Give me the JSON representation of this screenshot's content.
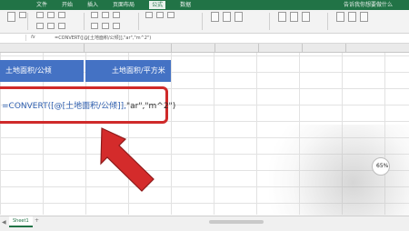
{
  "ribbon": {
    "tab_labels": [
      "文件",
      "开始",
      "插入",
      "页面布局",
      "公式",
      "数据"
    ],
    "right_tab_label": "告诉我你想要做什么"
  },
  "formula_bar": {
    "fx_label": "fx",
    "formula_text": "=CONVERT([@[土地面积/公倾]],\"ar\",\"m^2\")"
  },
  "table": {
    "header_1": "土地面积/公倾",
    "header_2": "土地面积/平方米"
  },
  "cell_formula": {
    "fn_part": "=CONVERT([@[土地面积/公倾]],",
    "arg_part": "\"ar\",\"m^2\")"
  },
  "overlay": {
    "percent": "65%"
  },
  "sheet_bar": {
    "tab_label": "Sheet1",
    "add_label": "+"
  },
  "colors": {
    "header_bg": "#4472c4",
    "highlight_border": "#cf2a2a",
    "arrow": "#d42b2b",
    "excel_green": "#217346"
  }
}
